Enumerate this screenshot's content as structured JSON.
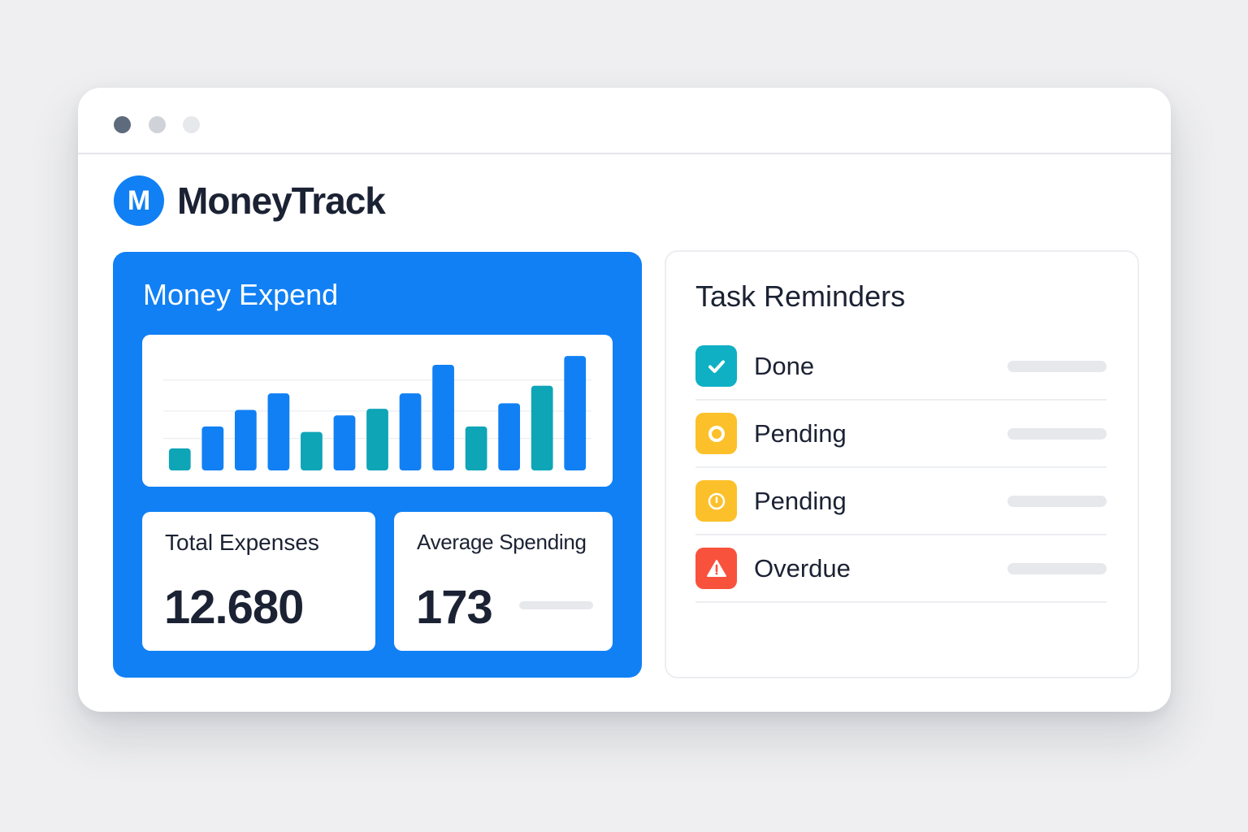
{
  "app": {
    "logo_letter": "M",
    "name": "MoneyTrack"
  },
  "colors": {
    "brand_blue": "#1180f4",
    "chart_blue": "#1180f4",
    "chart_teal": "#0ea5b7",
    "done": "#0fb0c4",
    "pending": "#fcc02b",
    "overdue": "#f8523d",
    "text": "#1b2233"
  },
  "expend": {
    "title": "Money Expend",
    "chart_data": {
      "type": "bar",
      "values": [
        2,
        4,
        5.5,
        7,
        3.5,
        5,
        5.6,
        7,
        9.6,
        4,
        6.1,
        7.7,
        10.4
      ],
      "colors": [
        "teal",
        "blue",
        "blue",
        "blue",
        "teal",
        "blue",
        "teal",
        "blue",
        "blue",
        "teal",
        "blue",
        "teal",
        "blue"
      ],
      "ylim": [
        0,
        11
      ],
      "grid": true
    }
  },
  "stats": {
    "total_label": "Total Expenses",
    "total_value": "12.680",
    "avg_label": "Average Spending",
    "avg_value": "173"
  },
  "tasks": {
    "title": "Task Reminders",
    "items": [
      {
        "label": "Done",
        "status": "done",
        "icon": "check-icon"
      },
      {
        "label": "Pending",
        "status": "pending",
        "icon": "ring-icon"
      },
      {
        "label": "Pending",
        "status": "pending",
        "icon": "clock-icon"
      },
      {
        "label": "Overdue",
        "status": "overdue",
        "icon": "warning-icon"
      }
    ]
  }
}
